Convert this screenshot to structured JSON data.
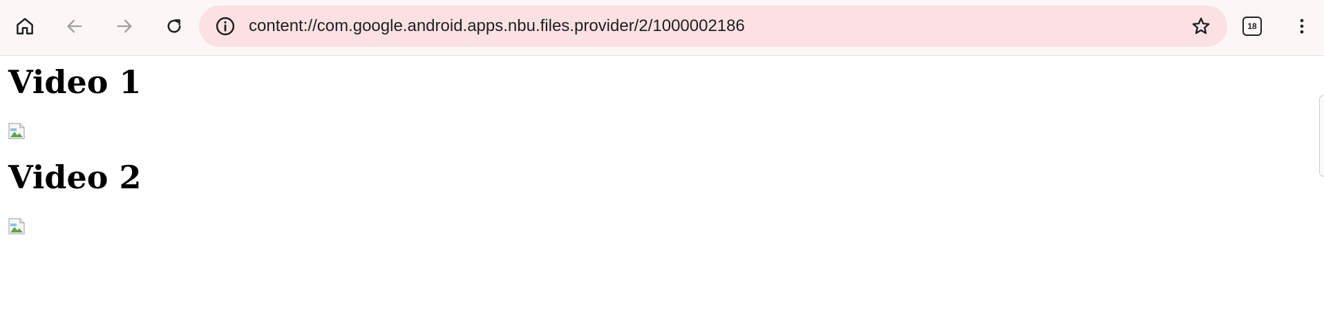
{
  "toolbar": {
    "url": "content://com.google.android.apps.nbu.files.provider/2/1000002186",
    "tab_count": "18"
  },
  "page": {
    "sections": [
      {
        "heading": "Video 1"
      },
      {
        "heading": "Video 2"
      }
    ]
  },
  "icons": {
    "home": "home-icon",
    "back": "arrow-left-icon",
    "forward": "arrow-right-icon",
    "reload": "reload-icon",
    "info": "info-icon",
    "star": "star-icon",
    "menu": "kebab-menu-icon",
    "broken_image": "broken-image-icon"
  },
  "colors": {
    "toolbar_bg": "#fdf6f6",
    "omnibox_bg": "#fbe1e3",
    "disabled_icon": "#9e9e9e"
  }
}
